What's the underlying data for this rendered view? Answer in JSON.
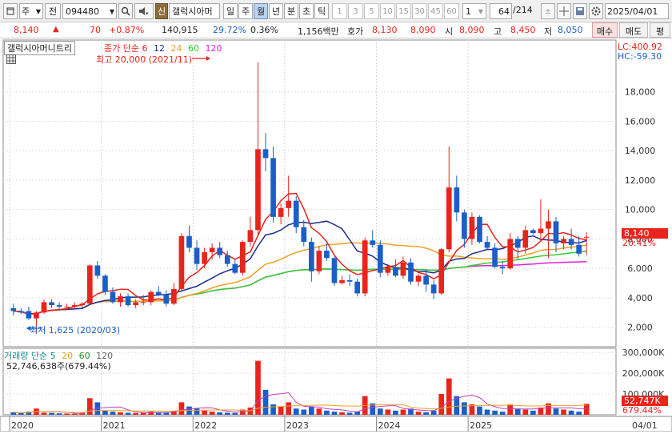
{
  "toolbar": {
    "type_label": "주",
    "jeon_label": "전",
    "stock_code": "094480",
    "sin_badge": "신",
    "stock_name": "갤럭시아머",
    "periods": [
      "일",
      "주",
      "월",
      "년",
      "분",
      "초",
      "틱"
    ],
    "active_period": "월",
    "minute_values": [
      "1",
      "3",
      "5",
      "10",
      "15",
      "30",
      "45",
      "60"
    ],
    "unit_value": "1",
    "view_count": "64",
    "total_count": "/214",
    "date_value": "2025/04/01"
  },
  "quote": {
    "price": "8,140",
    "change_arrow": "▲",
    "change": "70",
    "change_pct": "+0.87%",
    "volume": "140,915",
    "turnover_pct": "29.72%",
    "pct2": "0.36%",
    "amount": "1,156백만",
    "ask_label": "호가",
    "ask1": "8,130",
    "ask2": "8,090",
    "open_label": "시",
    "open": "8,090",
    "high_label": "고",
    "high": "8,450",
    "low_label": "저",
    "low": "8,050",
    "buy_button": "매수",
    "sell_button": "매도",
    "eval_button": "평"
  },
  "colors": {
    "up": "#e8241b",
    "down": "#1a5fc8",
    "ma5": "#e8241b",
    "ma12": "#1a2d8c",
    "ma24": "#f0a020",
    "ma60": "#2fd02f",
    "ma120": "#e020d8"
  },
  "price_panel": {
    "title": "갤럭시아머니트리",
    "legend_prefix": "종가 단순",
    "ma_periods": [
      "6",
      "12",
      "24",
      "60",
      "120"
    ],
    "max_label": "최고 20,000 (2021/11)",
    "min_label": "최저 1,625 (2020/03)",
    "lc_label": "LC:400.92",
    "hc_label": "HC:-59.30",
    "current_price_tag": "8,140",
    "current_pct_tag": "20.41%",
    "y_ticks": [
      "18,000",
      "16,000",
      "14,000",
      "12,000",
      "10,000",
      "8,000",
      "6,000",
      "4,000",
      "2,000"
    ]
  },
  "volume_panel": {
    "legend_prefix": "거래량 단순",
    "ma_periods": [
      "5",
      "20",
      "60",
      "120"
    ],
    "summary": "52,746,638주(679.44%)",
    "y_ticks": [
      "300,000K",
      "200,000K",
      "100,000K"
    ],
    "current_tag": "52,747K",
    "current_pct_tag": "679.44%"
  },
  "x_axis": {
    "labels": [
      "2020",
      "2021",
      "2022",
      "2023",
      "2024",
      "2025"
    ],
    "end_label": "04/01"
  },
  "chart_data": {
    "type": "candlestick",
    "title": "갤럭시아머니트리",
    "y_unit": "KRW",
    "ylim": [
      1000,
      20000
    ],
    "candles": [
      {
        "open": 3300,
        "high": 3600,
        "low": 2800,
        "close": 3100
      },
      {
        "open": 3100,
        "high": 3300,
        "low": 2900,
        "close": 3000
      },
      {
        "open": 3100,
        "high": 3400,
        "low": 2500,
        "close": 2600
      },
      {
        "open": 2600,
        "high": 3100,
        "low": 1625,
        "close": 3000
      },
      {
        "open": 3000,
        "high": 3900,
        "low": 2900,
        "close": 3700
      },
      {
        "open": 3700,
        "high": 3900,
        "low": 3300,
        "close": 3500
      },
      {
        "open": 3500,
        "high": 3700,
        "low": 3200,
        "close": 3400
      },
      {
        "open": 3400,
        "high": 3600,
        "low": 3200,
        "close": 3400
      },
      {
        "open": 3400,
        "high": 3700,
        "low": 3200,
        "close": 3500
      },
      {
        "open": 3500,
        "high": 3700,
        "low": 3300,
        "close": 3600
      },
      {
        "open": 3600,
        "high": 6300,
        "low": 3500,
        "close": 6200
      },
      {
        "open": 6200,
        "high": 6500,
        "low": 5300,
        "close": 5500
      },
      {
        "open": 5500,
        "high": 5600,
        "low": 4200,
        "close": 4400
      },
      {
        "open": 4400,
        "high": 4700,
        "low": 3600,
        "close": 3700
      },
      {
        "open": 3700,
        "high": 4300,
        "low": 3400,
        "close": 4100
      },
      {
        "open": 4100,
        "high": 4300,
        "low": 3400,
        "close": 3500
      },
      {
        "open": 3500,
        "high": 3900,
        "low": 3300,
        "close": 3700
      },
      {
        "open": 3700,
        "high": 4200,
        "low": 3500,
        "close": 3700
      },
      {
        "open": 3700,
        "high": 4500,
        "low": 3500,
        "close": 4400
      },
      {
        "open": 4400,
        "high": 4800,
        "low": 4100,
        "close": 4200
      },
      {
        "open": 4200,
        "high": 4500,
        "low": 3400,
        "close": 3600
      },
      {
        "open": 3600,
        "high": 5000,
        "low": 3500,
        "close": 4600
      },
      {
        "open": 4600,
        "high": 8400,
        "low": 4500,
        "close": 8200
      },
      {
        "open": 8200,
        "high": 8900,
        "low": 7100,
        "close": 7400
      },
      {
        "open": 7400,
        "high": 7900,
        "low": 5900,
        "close": 6300
      },
      {
        "open": 6300,
        "high": 7400,
        "low": 6000,
        "close": 7100
      },
      {
        "open": 7100,
        "high": 7700,
        "low": 6600,
        "close": 7400
      },
      {
        "open": 7400,
        "high": 7800,
        "low": 6700,
        "close": 6900
      },
      {
        "open": 6900,
        "high": 7200,
        "low": 6100,
        "close": 6300
      },
      {
        "open": 6300,
        "high": 6600,
        "low": 5600,
        "close": 5700
      },
      {
        "open": 5700,
        "high": 7900,
        "low": 5500,
        "close": 7800
      },
      {
        "open": 7800,
        "high": 9500,
        "low": 7500,
        "close": 8600
      },
      {
        "open": 8600,
        "high": 20000,
        "low": 8200,
        "close": 14100
      },
      {
        "open": 14100,
        "high": 15200,
        "low": 12600,
        "close": 13500
      },
      {
        "open": 13500,
        "high": 14300,
        "low": 9100,
        "close": 9500
      },
      {
        "open": 9500,
        "high": 10400,
        "low": 9000,
        "close": 10100
      },
      {
        "open": 10100,
        "high": 12300,
        "low": 9500,
        "close": 10600
      },
      {
        "open": 10600,
        "high": 10900,
        "low": 8400,
        "close": 8800
      },
      {
        "open": 8800,
        "high": 9300,
        "low": 7500,
        "close": 7800
      },
      {
        "open": 7800,
        "high": 8100,
        "low": 5100,
        "close": 5800
      },
      {
        "open": 5800,
        "high": 7500,
        "low": 5600,
        "close": 7200
      },
      {
        "open": 7200,
        "high": 7700,
        "low": 6500,
        "close": 6700
      },
      {
        "open": 6700,
        "high": 6800,
        "low": 4800,
        "close": 5000
      },
      {
        "open": 5000,
        "high": 5500,
        "low": 4900,
        "close": 5200
      },
      {
        "open": 5200,
        "high": 5600,
        "low": 4800,
        "close": 5100
      },
      {
        "open": 5100,
        "high": 5300,
        "low": 4100,
        "close": 4300
      },
      {
        "open": 4300,
        "high": 8100,
        "low": 4100,
        "close": 7900
      },
      {
        "open": 7900,
        "high": 8600,
        "low": 7400,
        "close": 7600
      },
      {
        "open": 7600,
        "high": 7900,
        "low": 5400,
        "close": 5700
      },
      {
        "open": 5700,
        "high": 6300,
        "low": 5500,
        "close": 6100
      },
      {
        "open": 6100,
        "high": 6600,
        "low": 5400,
        "close": 5500
      },
      {
        "open": 5500,
        "high": 6800,
        "low": 5300,
        "close": 6400
      },
      {
        "open": 6400,
        "high": 6700,
        "low": 4900,
        "close": 5100
      },
      {
        "open": 5100,
        "high": 5600,
        "low": 4800,
        "close": 5500
      },
      {
        "open": 5500,
        "high": 5900,
        "low": 4400,
        "close": 4900
      },
      {
        "open": 4900,
        "high": 5200,
        "low": 3900,
        "close": 4300
      },
      {
        "open": 4300,
        "high": 7400,
        "low": 4200,
        "close": 7300
      },
      {
        "open": 7300,
        "high": 14300,
        "low": 7100,
        "close": 11500
      },
      {
        "open": 11500,
        "high": 12300,
        "low": 9200,
        "close": 9800
      },
      {
        "open": 9800,
        "high": 10000,
        "low": 7400,
        "close": 8000
      },
      {
        "open": 8000,
        "high": 9800,
        "low": 7600,
        "close": 9500
      },
      {
        "open": 9500,
        "high": 9600,
        "low": 7700,
        "close": 7800
      },
      {
        "open": 7800,
        "high": 8200,
        "low": 7300,
        "close": 7400
      },
      {
        "open": 7400,
        "high": 7700,
        "low": 6000,
        "close": 6100
      },
      {
        "open": 6100,
        "high": 6500,
        "low": 5600,
        "close": 6000
      },
      {
        "open": 6000,
        "high": 8400,
        "low": 5900,
        "close": 8000
      },
      {
        "open": 8000,
        "high": 8200,
        "low": 6600,
        "close": 7400
      },
      {
        "open": 7400,
        "high": 8900,
        "low": 7000,
        "close": 8600
      },
      {
        "open": 8600,
        "high": 8700,
        "low": 8300,
        "close": 8400
      },
      {
        "open": 8400,
        "high": 10700,
        "low": 7800,
        "close": 8700
      },
      {
        "open": 8700,
        "high": 10000,
        "low": 6700,
        "close": 9200
      },
      {
        "open": 9200,
        "high": 9500,
        "low": 7100,
        "close": 7700
      },
      {
        "open": 7700,
        "high": 8200,
        "low": 7300,
        "close": 8000
      },
      {
        "open": 8000,
        "high": 8700,
        "low": 7300,
        "close": 7600
      },
      {
        "open": 7600,
        "high": 8200,
        "low": 6800,
        "close": 7000
      },
      {
        "open": 8090,
        "high": 8450,
        "low": 6900,
        "close": 8140
      }
    ],
    "volume_ylim": [
      0,
      320000
    ],
    "volume": [
      12000,
      8000,
      15000,
      30000,
      10000,
      9000,
      7000,
      6000,
      5000,
      8000,
      80000,
      60000,
      20000,
      15000,
      12000,
      10000,
      8000,
      9000,
      15000,
      12000,
      10000,
      18000,
      60000,
      40000,
      30000,
      20000,
      15000,
      12000,
      10000,
      9000,
      25000,
      35000,
      260000,
      120000,
      50000,
      40000,
      60000,
      30000,
      25000,
      40000,
      30000,
      20000,
      15000,
      12000,
      10000,
      15000,
      90000,
      55000,
      30000,
      25000,
      20000,
      25000,
      30000,
      15000,
      12000,
      20000,
      100000,
      175000,
      90000,
      60000,
      50000,
      40000,
      25000,
      20000,
      15000,
      50000,
      30000,
      25000,
      20000,
      35000,
      55000,
      30000,
      25000,
      20000,
      15000,
      52747
    ]
  }
}
